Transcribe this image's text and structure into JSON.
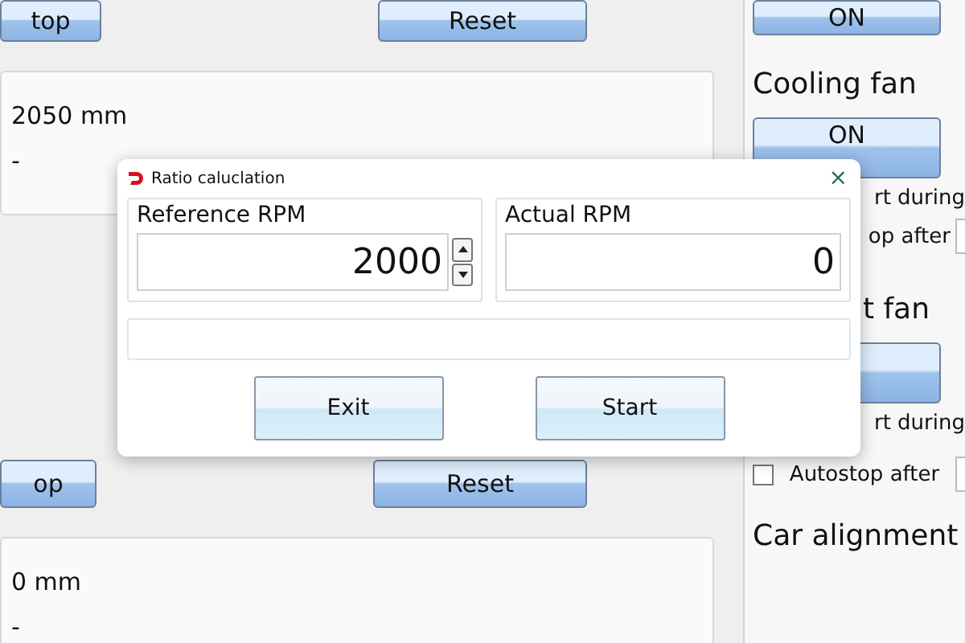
{
  "left_panel": {
    "top_buttons": [
      {
        "label": "top"
      },
      {
        "label": "Reset"
      }
    ],
    "upper_readout": {
      "value": "2050 mm",
      "status": "-"
    },
    "lower_buttons": [
      {
        "label": "op"
      },
      {
        "label": "Reset"
      }
    ],
    "lower_readout": {
      "value": "0 mm",
      "status": "-"
    }
  },
  "right_panel": {
    "top_button": {
      "label": "ON"
    },
    "sections": [
      {
        "title": "Cooling fan",
        "button": true,
        "button_label": "ON",
        "options": [
          {
            "kind": "text",
            "label": "rt during"
          },
          {
            "kind": "field",
            "label": "op after"
          }
        ]
      },
      {
        "title": "t fan",
        "button": true,
        "options": [
          {
            "kind": "text",
            "label": "rt during"
          },
          {
            "kind": "checkbox",
            "label": "Autostop after",
            "checked": false
          }
        ]
      },
      {
        "title": "Car alignment",
        "button": false
      }
    ]
  },
  "dialog": {
    "title": "Ratio caluclation",
    "close_label": "×",
    "groups": [
      {
        "label": "Reference RPM",
        "value": "2000",
        "spinner": true
      },
      {
        "label": "Actual RPM",
        "value": "0",
        "spinner": false
      }
    ],
    "buttons": [
      {
        "label": "Exit"
      },
      {
        "label": "Start"
      }
    ]
  }
}
